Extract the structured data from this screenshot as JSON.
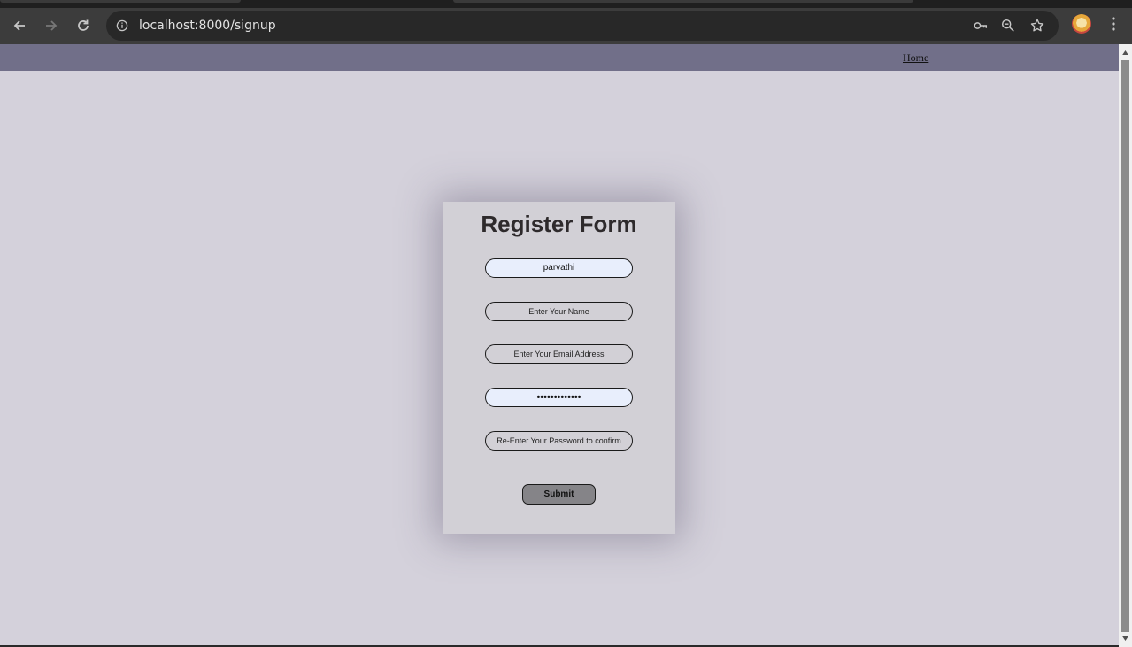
{
  "browser": {
    "url": "localhost:8000/signup",
    "icons": [
      "back-arrow-icon",
      "forward-arrow-icon",
      "reload-icon",
      "site-info-icon",
      "password-key-icon",
      "zoom-icon",
      "bookmark-star-icon",
      "profile-avatar",
      "more-menu-icon"
    ]
  },
  "navbar": {
    "home_label": "Home",
    "background": "#716f89"
  },
  "form": {
    "title": "Register Form",
    "fields": [
      {
        "name": "username-field",
        "value": "parvathi",
        "placeholder": ""
      },
      {
        "name": "name-field",
        "value": "",
        "placeholder": "Enter Your Name"
      },
      {
        "name": "email-field",
        "value": "",
        "placeholder": "Enter Your Email Address"
      },
      {
        "name": "password-field",
        "value": "•••••••••••••",
        "placeholder": ""
      },
      {
        "name": "confirm-password-field",
        "value": "",
        "placeholder": "Re-Enter Your Password to confirm"
      }
    ],
    "submit_label": "Submit"
  },
  "colors": {
    "page_background": "#d4d1db",
    "card_background": "#d2d0d6",
    "autofill_background": "#e8eefc",
    "submit_background": "#858488"
  }
}
